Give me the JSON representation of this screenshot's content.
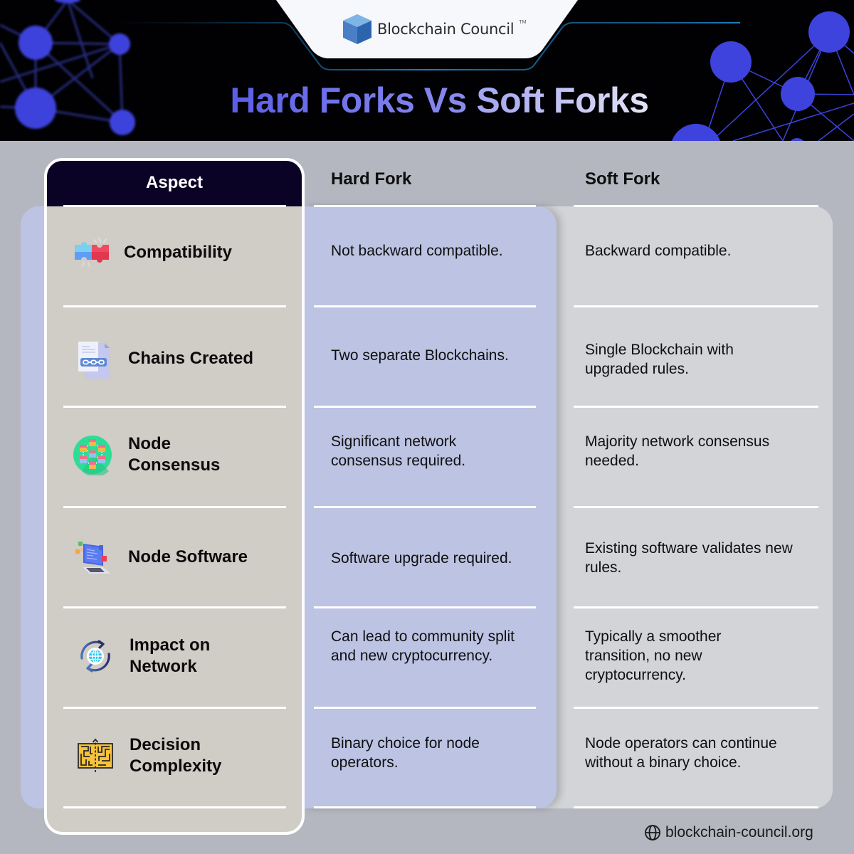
{
  "brand": {
    "name": "Blockchain Council",
    "trademark": "TM"
  },
  "title": {
    "part1": "Hard Forks Vs",
    "part2": "Soft Forks",
    "gradient_start": "#5a5ee8",
    "gradient_end": "#e3e3f7"
  },
  "table": {
    "headers": {
      "aspect": "Aspect",
      "hard_fork": "Hard Fork",
      "soft_fork": "Soft Fork"
    },
    "rows": [
      {
        "icon": "puzzle-icon",
        "aspect": "Compatibility",
        "hard_fork": "Not backward compatible.",
        "soft_fork": "Backward compatible."
      },
      {
        "icon": "linked-document-icon",
        "aspect": "Chains Created",
        "hard_fork": "Two separate Blockchains.",
        "soft_fork": "Single Blockchain with upgraded rules."
      },
      {
        "icon": "blockchain-network-icon",
        "aspect": "Node Consensus",
        "hard_fork": "Significant network consensus required.",
        "soft_fork": "Majority network consensus needed."
      },
      {
        "icon": "laptop-code-icon",
        "aspect": "Node Software",
        "hard_fork": "Software upgrade required.",
        "soft_fork": "Existing software validates new rules."
      },
      {
        "icon": "globe-sync-icon",
        "aspect": "Impact on Network",
        "hard_fork": "Can lead to community split and new cryptocurrency.",
        "soft_fork": "Typically a smoother transition, no new cryptocurrency."
      },
      {
        "icon": "maze-icon",
        "aspect": "Decision Complexity",
        "hard_fork": "Binary choice for node operators.",
        "soft_fork": "Node operators can continue without a binary choice."
      }
    ]
  },
  "footer": {
    "icon": "globe-icon",
    "url_text": "blockchain-council.org"
  },
  "colors": {
    "header_bg": "#010104",
    "network_blue": "#3d43dc",
    "aspect_head_bg": "#0b0326",
    "aspect_col_bg": "#d0ccc6",
    "hard_fork_bg": "#bcc3e3",
    "soft_fork_bg": "#d3d4d8",
    "page_bg": "#b4b7c0"
  }
}
